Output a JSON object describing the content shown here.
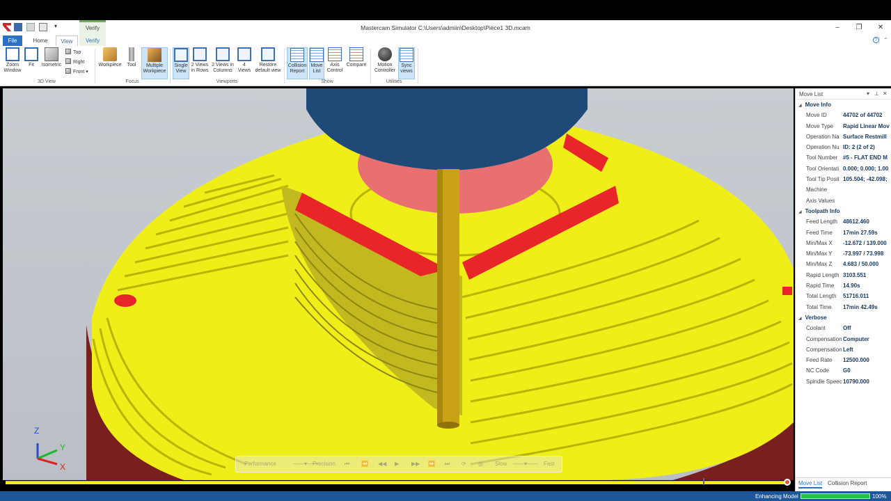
{
  "window": {
    "title": "Mastercam Simulator  C:\\Users\\admiin\\Desktop\\Pièce1 3D.mcam",
    "context_tab": "Verify"
  },
  "ribbon_tabs": [
    {
      "label": "File"
    },
    {
      "label": "Home"
    },
    {
      "label": "View",
      "active": true
    },
    {
      "label": "Verify"
    }
  ],
  "ribbon": {
    "view3d": {
      "group": "3D View",
      "zoom_window": "Zoom\nWindow",
      "fit": "Fit",
      "isometric": "Isometric",
      "top": "Top",
      "right": "Right",
      "front": "Front"
    },
    "focus": {
      "group": "Focus",
      "workpiece": "Workpiece",
      "tool": "Tool",
      "multiple_workpiece": "Multiple\nWorkpiece"
    },
    "viewports": {
      "group": "Viewports",
      "single_view": "Single\nView",
      "two_rows": "2 Views\nin Rows",
      "two_columns": "2 Views in\nColumns",
      "four_views": "4\nViews",
      "restore": "Restore\ndefault view"
    },
    "show": {
      "group": "Show",
      "collision_report": "Collision\nReport",
      "move_list": "Move\nList",
      "axis_control": "Axis\nControl",
      "compare": "Compare"
    },
    "utilities": {
      "group": "Utilities",
      "motion_controller": "Motion\nController",
      "sync_views": "Sync\nviews"
    }
  },
  "sim_controls": {
    "performance": "Performance",
    "precision": "Precision",
    "slow": "Slow",
    "fast": "Fast"
  },
  "triad": {
    "z": "Z",
    "y": "Y",
    "x": "X"
  },
  "panel": {
    "title": "Move List",
    "sections": [
      {
        "name": "Move Info",
        "rows": [
          {
            "label": "Move ID",
            "value": "44702 of 44702"
          },
          {
            "label": "Move Type",
            "value": "Rapid Linear Mov"
          },
          {
            "label": "Operation Na",
            "value": "Surface Restmill"
          },
          {
            "label": "Operation Nu",
            "value": "ID: 2 (2 of 2)"
          },
          {
            "label": "Tool Number",
            "value": "#5 - FLAT END M"
          },
          {
            "label": "Tool Orientati",
            "value": "0.000; 0.000; 1.00"
          },
          {
            "label": "Tool Tip Posit",
            "value": "105.504; -42.098;"
          },
          {
            "label": "Machine",
            "value": ""
          },
          {
            "label": "Axis Values",
            "value": ""
          }
        ]
      },
      {
        "name": "Toolpath Info",
        "rows": [
          {
            "label": "Feed Length",
            "value": "48612.460"
          },
          {
            "label": "Feed Time",
            "value": "17min 27.59s"
          },
          {
            "label": "Min/Max X",
            "value": "-12.672 / 139.000"
          },
          {
            "label": "Min/Max Y",
            "value": "-73.997 / 73.998"
          },
          {
            "label": "Min/Max Z",
            "value": "4.683 / 50.000"
          },
          {
            "label": "Rapid Length",
            "value": "3103.551"
          },
          {
            "label": "Rapid Time",
            "value": "14.90s"
          },
          {
            "label": "Total Length",
            "value": "51716.011"
          },
          {
            "label": "Total Time",
            "value": "17min 42.49s"
          }
        ]
      },
      {
        "name": "Verbose",
        "rows": [
          {
            "label": "Coolant",
            "value": "Off"
          },
          {
            "label": "Compensation",
            "value": "Computer"
          },
          {
            "label": "Compensation",
            "value": "Left"
          },
          {
            "label": "Feed Rate",
            "value": "12500.000"
          },
          {
            "label": "NC Code",
            "value": "G0"
          },
          {
            "label": "Spindle Speec",
            "value": "10790.000"
          }
        ]
      }
    ],
    "tabs": [
      {
        "label": "Move List"
      },
      {
        "label": "Collision Report"
      }
    ]
  },
  "status": {
    "label": "Enhancing Model",
    "progress": 100,
    "progress_text": "100%"
  },
  "colors": {
    "accent": "#2a73c4",
    "stock": "#f0ee18",
    "collision": "#e8262a",
    "holder": "#1f4a78",
    "tool": "#c8a214",
    "status_bar": "#1e5799"
  }
}
